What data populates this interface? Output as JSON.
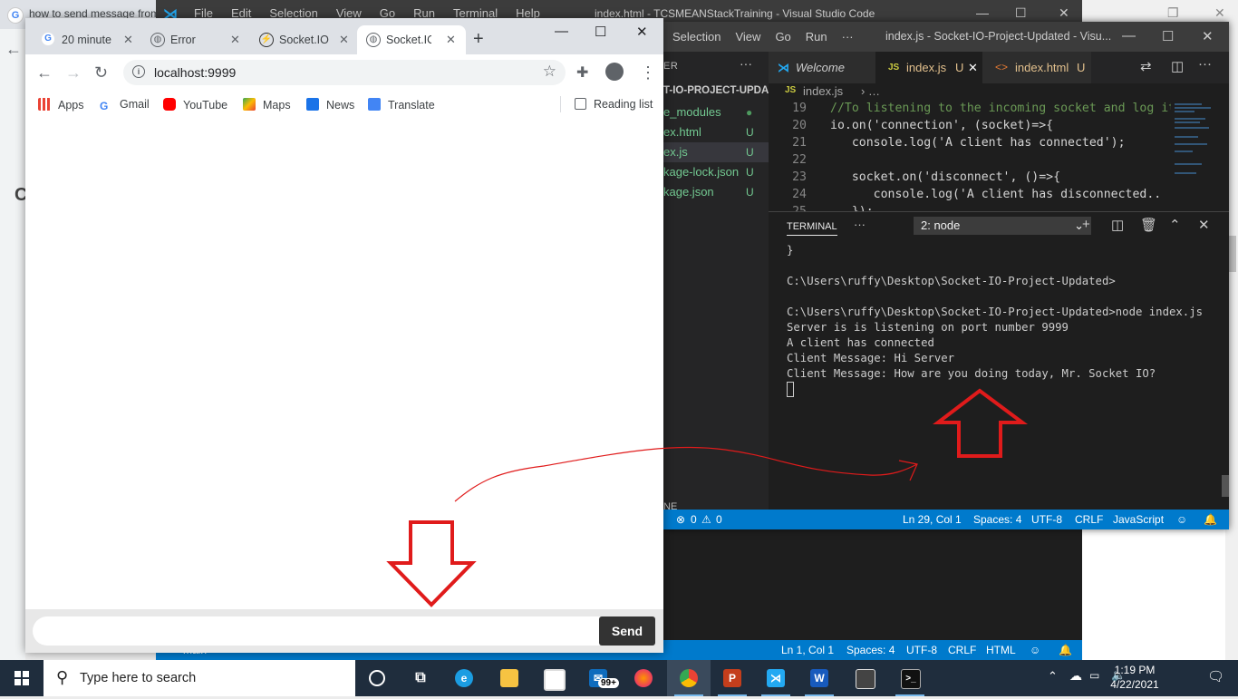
{
  "background_browser": {
    "tab_title": "how to send message from"
  },
  "vscode_back": {
    "menu": [
      "File",
      "Edit",
      "Selection",
      "View",
      "Go",
      "Run",
      "Terminal",
      "Help"
    ],
    "title": "index.html - TCSMEANStackTraining - Visual Studio Code",
    "status": {
      "branch": "main",
      "errors": "0",
      "warnings": "0",
      "position": "Ln 1, Col 1",
      "spaces": "Spaces: 4",
      "encoding": "UTF-8",
      "eol": "CRLF",
      "language": "HTML"
    }
  },
  "vscode_front": {
    "menu": [
      "Selection",
      "View",
      "Go",
      "Run",
      "···"
    ],
    "title": "index.js - Socket-IO-Project-Updated - Visu...",
    "explorer_header": "ER",
    "project": "T-IO-PROJECT-UPDA...",
    "files": [
      {
        "name": "e_modules",
        "status": "●"
      },
      {
        "name": "ex.html",
        "status": "U"
      },
      {
        "name": "ex.js",
        "status": "U"
      },
      {
        "name": "kage-lock.json",
        "status": "U"
      },
      {
        "name": "kage.json",
        "status": "U"
      }
    ],
    "outline_1": "NE",
    "outline_2": "NE",
    "tabs": [
      {
        "label": "Welcome",
        "badge": "",
        "icon": "vscode-icon"
      },
      {
        "label": "index.js",
        "badge": "U",
        "icon": "js-icon"
      },
      {
        "label": "index.html",
        "badge": "U",
        "icon": "html-icon"
      }
    ],
    "breadcrumb": "index.js",
    "code": [
      {
        "n": "19",
        "text": "//To listening to the incoming socket and log it"
      },
      {
        "n": "20",
        "text": "io.on('connection', (socket)=>{"
      },
      {
        "n": "21",
        "text": "   console.log('A client has connected');"
      },
      {
        "n": "22",
        "text": ""
      },
      {
        "n": "23",
        "text": "   socket.on('disconnect', ()=>{"
      },
      {
        "n": "24",
        "text": "      console.log('A client has disconnected.."
      },
      {
        "n": "25",
        "text": "   });"
      }
    ],
    "terminal": {
      "label": "TERMINAL",
      "selected": "2: node",
      "lines": [
        "}",
        "",
        "C:\\Users\\ruffy\\Desktop\\Socket-IO-Project-Updated>",
        "",
        "C:\\Users\\ruffy\\Desktop\\Socket-IO-Project-Updated>node index.js",
        "Server is is listening on port number 9999",
        "A client has connected",
        "Client Message: Hi Server",
        "Client Message: How are you doing today, Mr. Socket IO?"
      ]
    },
    "status": {
      "errors": "0",
      "warnings": "0",
      "position": "Ln 29, Col 1",
      "spaces": "Spaces: 4",
      "encoding": "UTF-8",
      "eol": "CRLF",
      "language": "JavaScript"
    }
  },
  "chrome": {
    "tabs": [
      {
        "label": "20 minute",
        "icon": "google-icon"
      },
      {
        "label": "Error",
        "icon": "globe-icon"
      },
      {
        "label": "Socket.IO",
        "icon": "socketio-icon"
      },
      {
        "label": "Socket.IO",
        "icon": "globe-icon"
      }
    ],
    "url": "localhost:9999",
    "bookmarks": [
      {
        "label": "Apps",
        "color": "#ea4335"
      },
      {
        "label": "Gmail",
        "color": "#4285f4"
      },
      {
        "label": "YouTube",
        "color": "#ff0000"
      },
      {
        "label": "Maps",
        "color": "#34a853"
      },
      {
        "label": "News",
        "color": "#1a73e8"
      },
      {
        "label": "Translate",
        "color": "#4285f4"
      }
    ],
    "reading_list": "Reading list",
    "message_input": {
      "value": "",
      "placeholder": ""
    },
    "send_label": "Send"
  },
  "taskbar": {
    "search_placeholder": "Type here to search",
    "mail_badge": "99+",
    "time": "1:19 PM",
    "date": "4/22/2021"
  },
  "colors": {
    "accent": "#007acc",
    "annotation": "#e01b1b"
  }
}
